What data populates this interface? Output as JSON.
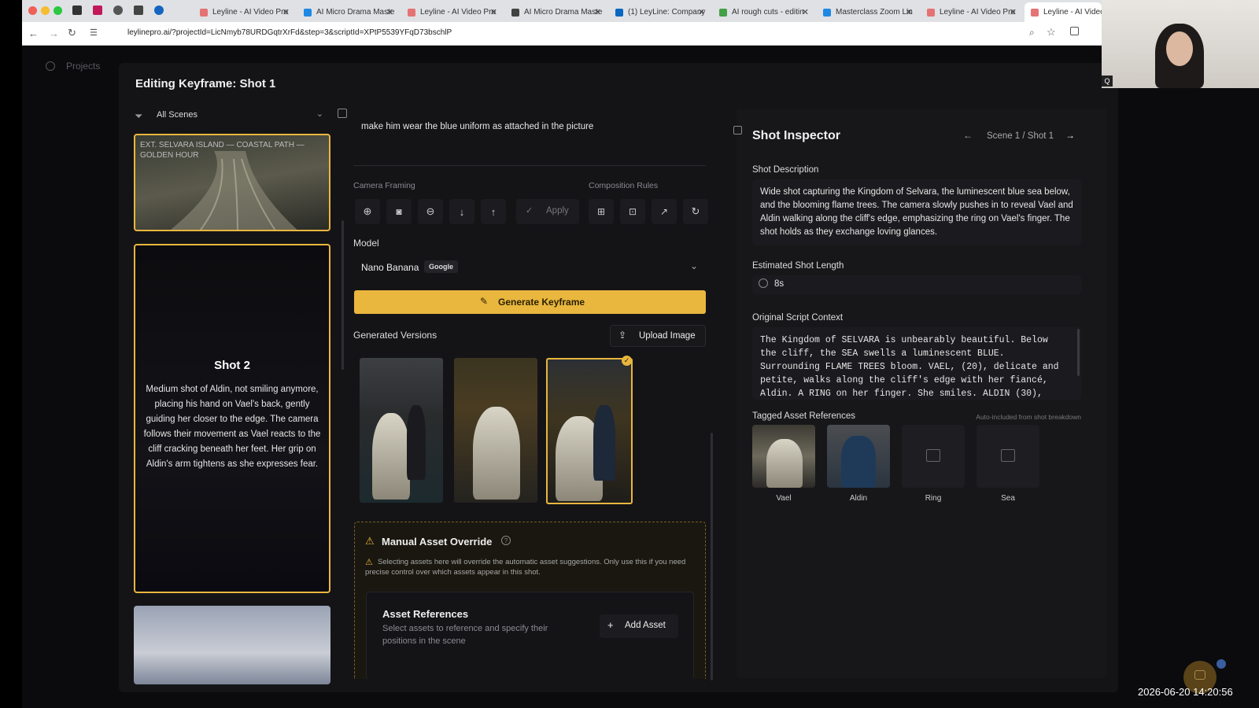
{
  "browser": {
    "tabs": [
      {
        "label": "Leyline - AI Video Pro",
        "active": false
      },
      {
        "label": "AI Micro Drama Maste",
        "active": false
      },
      {
        "label": "Leyline - AI Video Pro",
        "active": false
      },
      {
        "label": "AI Micro Drama Maste",
        "active": false
      },
      {
        "label": "(1) LeyLine: Company",
        "active": false
      },
      {
        "label": "AI rough cuts - editin",
        "active": false
      },
      {
        "label": "Masterclass Zoom Lin",
        "active": false
      },
      {
        "label": "Leyline - AI Video Pro",
        "active": false
      },
      {
        "label": "Leyline - AI Video Pro",
        "active": true
      }
    ],
    "url": "leylinepro.ai/?projectId=LicNmyb78URDGqtrXrFd&step=3&scriptId=XPtP5539YFqD73bschlP"
  },
  "app": {
    "nav_projects": "Projects"
  },
  "modal": {
    "title": "Editing Keyframe: Shot 1"
  },
  "scenes": {
    "filter_label": "All Scenes",
    "card1_caption": "EXT. SELVARA ISLAND — COASTAL PATH — GOLDEN HOUR",
    "shot2_title": "Shot 2",
    "shot2_desc": "Medium shot of Aldin, not smiling anymore, placing his hand on Vael's back, gently guiding her closer to the edge. The camera follows their movement as Vael reacts to the cliff cracking beneath her feet. Her grip on Aldin's arm tightens as she expresses fear."
  },
  "editor": {
    "prompt": "make him wear the blue uniform as attached in the picture",
    "camera_framing_label": "Camera Framing",
    "composition_rules_label": "Composition Rules",
    "apply_label": "Apply",
    "model_label": "Model",
    "model_value": "Nano Banana",
    "model_badge": "Google",
    "generate_label": "Generate Keyframe",
    "versions_label": "Generated Versions",
    "upload_label": "Upload Image",
    "override_title": "Manual Asset Override",
    "override_warning": "Selecting assets here will override the automatic asset suggestions. Only use this if you need precise control over which assets appear in this shot.",
    "asset_refs_title": "Asset References",
    "asset_refs_desc": "Select assets to reference and specify their positions in the scene",
    "add_asset_label": "Add Asset"
  },
  "inspector": {
    "title": "Shot Inspector",
    "nav": "Scene 1 / Shot 1",
    "desc_label": "Shot Description",
    "desc": "Wide shot capturing the Kingdom of Selvara, the luminescent blue sea below, and the blooming flame trees. The camera slowly pushes in to reveal Vael and Aldin walking along the cliff's edge, emphasizing the ring on Vael's finger. The shot holds as they exchange loving glances.",
    "length_label": "Estimated Shot Length",
    "length_value": "8s",
    "context_label": "Original Script Context",
    "context": "The Kingdom of SELVARA is unbearably beautiful. Below the cliff, the SEA swells a luminescent BLUE. Surrounding FLAME TREES bloom. VAEL, (20), delicate and petite, walks along the cliff's edge with her fiancé, Aldin. A RING on her finger. She smiles. ALDIN (30),",
    "tagged_label": "Tagged Asset References",
    "tagged_note": "Auto-included from shot breakdown",
    "assets": [
      "Vael",
      "Aldin",
      "Ring",
      "Sea"
    ]
  },
  "overlay": {
    "timestamp": "2026-06-20 14:20:56",
    "webcam_badge": "Q"
  },
  "colors": {
    "accent": "#e9b63e",
    "background": "#0b0b0d",
    "panel": "#141417"
  }
}
